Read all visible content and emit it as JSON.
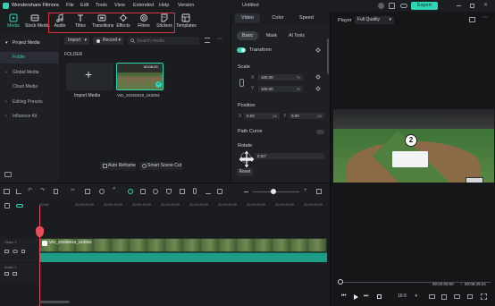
{
  "app": {
    "title": "Wondershare Filmora",
    "project": "Untitled",
    "export_label": "Export"
  },
  "menu": [
    "File",
    "Edit",
    "Tools",
    "View",
    "Extended",
    "Help",
    "Version"
  ],
  "toolbar": {
    "media": "Media",
    "stock_media": "Stock Media",
    "audio": "Audio",
    "titles": "Titles",
    "transitions": "Transitions",
    "effects": "Effects",
    "filters": "Filters",
    "stickers": "Stickers",
    "templates": "Templates"
  },
  "media_panel": {
    "import_label": "Import",
    "record_label": "Record",
    "search_placeholder": "Search media",
    "folder_header": "FOLDER",
    "import_tile": "Import Media",
    "clip_name": "VID_20250818_163053",
    "clip_duration": "00:08:29",
    "auto_reframe": "Auto Reframe",
    "smart_scene_cut": "Smart Scene Cut"
  },
  "left_nav": {
    "project_media": "Project Media",
    "folder": "Folder",
    "global_media": "Global Media",
    "cloud_media": "Cloud Media",
    "editing_presets": "Editing Presets",
    "influence_kit": "Influence Kit"
  },
  "inspector": {
    "tabs": [
      "Video",
      "Color",
      "Speed"
    ],
    "subtabs": [
      "Basic",
      "Mask",
      "AI Tools"
    ],
    "transform": "Transform",
    "scale": "Scale",
    "scale_x_label": "X",
    "scale_x": "100.00",
    "scale_y_label": "Y",
    "scale_y": "100.00",
    "percent": "%",
    "position": "Position",
    "pos_x_label": "X",
    "pos_x": "0.00",
    "pos_y_label": "Y",
    "pos_y": "0.00",
    "px": "px",
    "path_curve": "Path Curve",
    "rotate": "Rotate",
    "rotate_value": "0.00°",
    "reset": "Reset"
  },
  "player": {
    "label": "Player",
    "quality": "Full Quality",
    "current_time": "00:00:00:00",
    "separator": "/",
    "total_time": "00:08:29:24",
    "ratio": "16:9"
  },
  "overlay": {
    "step_number": "2"
  },
  "timeline": {
    "ruler": [
      "00:00",
      "00:00:05:00",
      "00:00:10:00",
      "00:00:15:00",
      "00:00:20:00",
      "00:00:25:00",
      "00:00:30:00",
      "00:00:35:00",
      "00:00:40:00",
      "00:00:45:00"
    ],
    "video_track": "Video 1",
    "audio_track": "Audio 1",
    "clip_label": "VID_20250818_163053"
  },
  "colors": {
    "accent": "#2fd6b6",
    "highlight": "#e0333d",
    "playhead": "#e84c5b",
    "audio_wave": "#1d9c88"
  }
}
